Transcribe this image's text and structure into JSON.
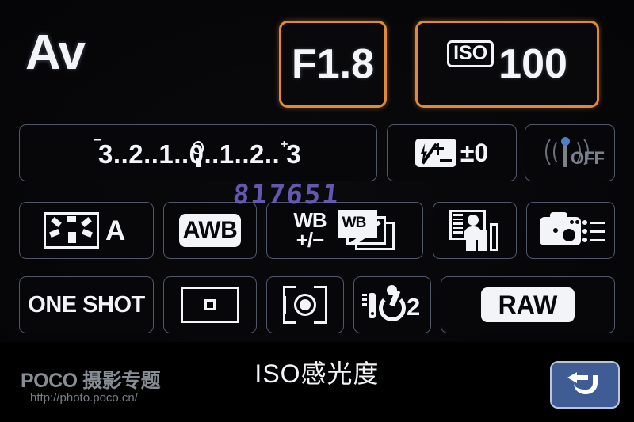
{
  "device": {
    "screen_name": "camera-quick-control-screen",
    "accent_highlight_color": "#e08a35",
    "panel_background_color": "#000000",
    "text_color": "#f2f4f8",
    "return_button_color": "#3f5d94"
  },
  "top": {
    "shooting_mode": "Av",
    "aperture": "F1.8",
    "iso_tag": "ISO",
    "iso_value": "100"
  },
  "exposure": {
    "scale_minus_sign": "‾",
    "scale_text": "3..2..1..0..1..2..",
    "scale_plus_sign": "⁺",
    "scale_plus_value": "3",
    "full_scale_label": "‾3..2..1..0..1..2..⁺3",
    "indicator_position": "0"
  },
  "flash": {
    "icon_name": "flash-exposure-compensation-icon",
    "value": "±0"
  },
  "wireless": {
    "icon_name": "wireless-flash-icon",
    "status": "OFF"
  },
  "picture_style": {
    "icon_name": "picture-style-icon",
    "letter": "A"
  },
  "white_balance": {
    "mode": "AWB",
    "shift_line1": "WB",
    "shift_line2": "+/−",
    "bracket_label": "WB"
  },
  "auto_lighting_optimizer": {
    "icon_name": "auto-lighting-optimizer-icon"
  },
  "custom_functions": {
    "icon_name": "custom-controls-icon"
  },
  "af": {
    "mode": "ONE SHOT",
    "area_icon_name": "af-point-selection-icon"
  },
  "metering": {
    "icon_name": "evaluative-metering-icon"
  },
  "drive": {
    "icon_name": "self-timer-remote-icon",
    "seconds": "2"
  },
  "image_quality": {
    "format": "RAW"
  },
  "bottom": {
    "guide_text": "ISO感光度",
    "return_icon_name": "return-arrow-icon"
  },
  "watermark": {
    "brand": "POCO 摄影专题",
    "url": "http://photo.poco.cn/",
    "serial": "817651"
  }
}
